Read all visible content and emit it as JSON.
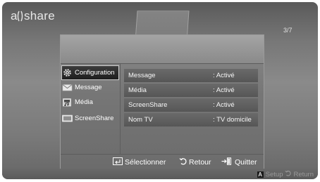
{
  "brand": {
    "logo_text": "allshare"
  },
  "page_indicator": "3/7",
  "sidebar": {
    "items": [
      {
        "label": "Configuration",
        "icon": "gear-icon",
        "active": true
      },
      {
        "label": "Message",
        "icon": "envelope-icon",
        "active": false
      },
      {
        "label": "Média",
        "icon": "media-icon",
        "active": false
      },
      {
        "label": "ScreenShare",
        "icon": "screen-icon",
        "active": false
      }
    ]
  },
  "settings": {
    "rows": [
      {
        "name": "Message",
        "value": ": Activé"
      },
      {
        "name": "Média",
        "value": ": Activé"
      },
      {
        "name": "ScreenShare",
        "value": ": Activé"
      },
      {
        "name": "Nom TV",
        "value": ": TV domicile"
      }
    ]
  },
  "footer": {
    "select_label": "Sélectionner",
    "back_label": "Retour",
    "quit_label": "Quitter"
  },
  "bottom_bar": {
    "key_a": "A",
    "setup_label": "Setup",
    "return_label": "Return"
  },
  "colors": {
    "background": "#777777",
    "dialog": "#7a7a7a",
    "row": "#5e5e5e",
    "active_item": "#262626",
    "text": "#ffffff"
  }
}
